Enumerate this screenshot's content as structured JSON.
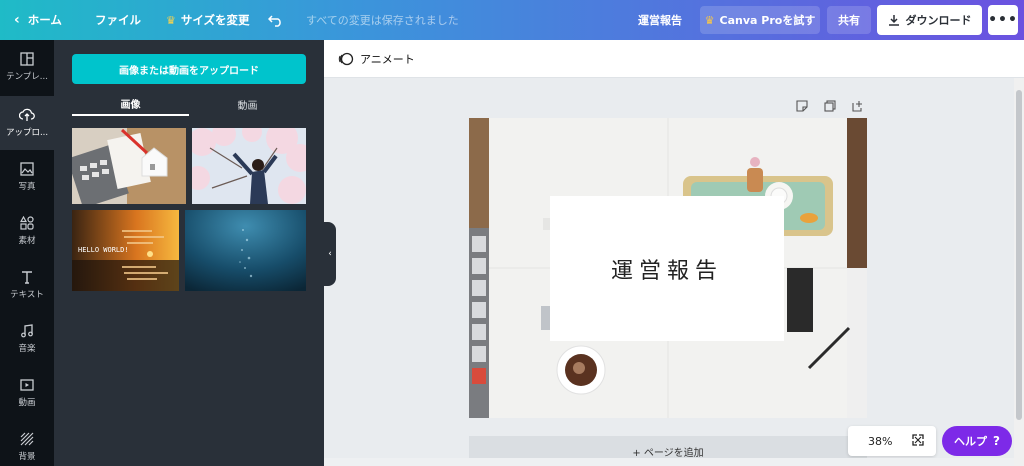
{
  "topbar": {
    "home": "ホーム",
    "file": "ファイル",
    "resize": "サイズを変更",
    "saved_status": "すべての変更は保存されました",
    "doc_title": "運営報告",
    "pro": "Canva Proを試す",
    "share": "共有",
    "download": "ダウンロード",
    "more": "•••"
  },
  "rail": {
    "items": [
      {
        "label": "テンプレ...",
        "icon": "template-icon"
      },
      {
        "label": "アップロ...",
        "icon": "upload-icon"
      },
      {
        "label": "写真",
        "icon": "photo-icon"
      },
      {
        "label": "素材",
        "icon": "elements-icon"
      },
      {
        "label": "テキスト",
        "icon": "text-icon"
      },
      {
        "label": "音楽",
        "icon": "music-icon"
      },
      {
        "label": "動画",
        "icon": "video-icon"
      },
      {
        "label": "背景",
        "icon": "background-icon"
      }
    ]
  },
  "panel": {
    "upload_button": "画像または動画をアップロード",
    "tabs": [
      "画像",
      "動画"
    ],
    "thumb_text": "HELLO WORLD!"
  },
  "editor": {
    "animate": "アニメート",
    "page_title": "運営報告",
    "add_page": "+ ページを追加",
    "zoom": "38%",
    "help": "ヘルプ",
    "help_q": "?"
  },
  "colors": {
    "accent": "#00c4cc",
    "purple": "#7d2ae8",
    "dark_rail": "#0e1318",
    "panel": "#293039"
  }
}
